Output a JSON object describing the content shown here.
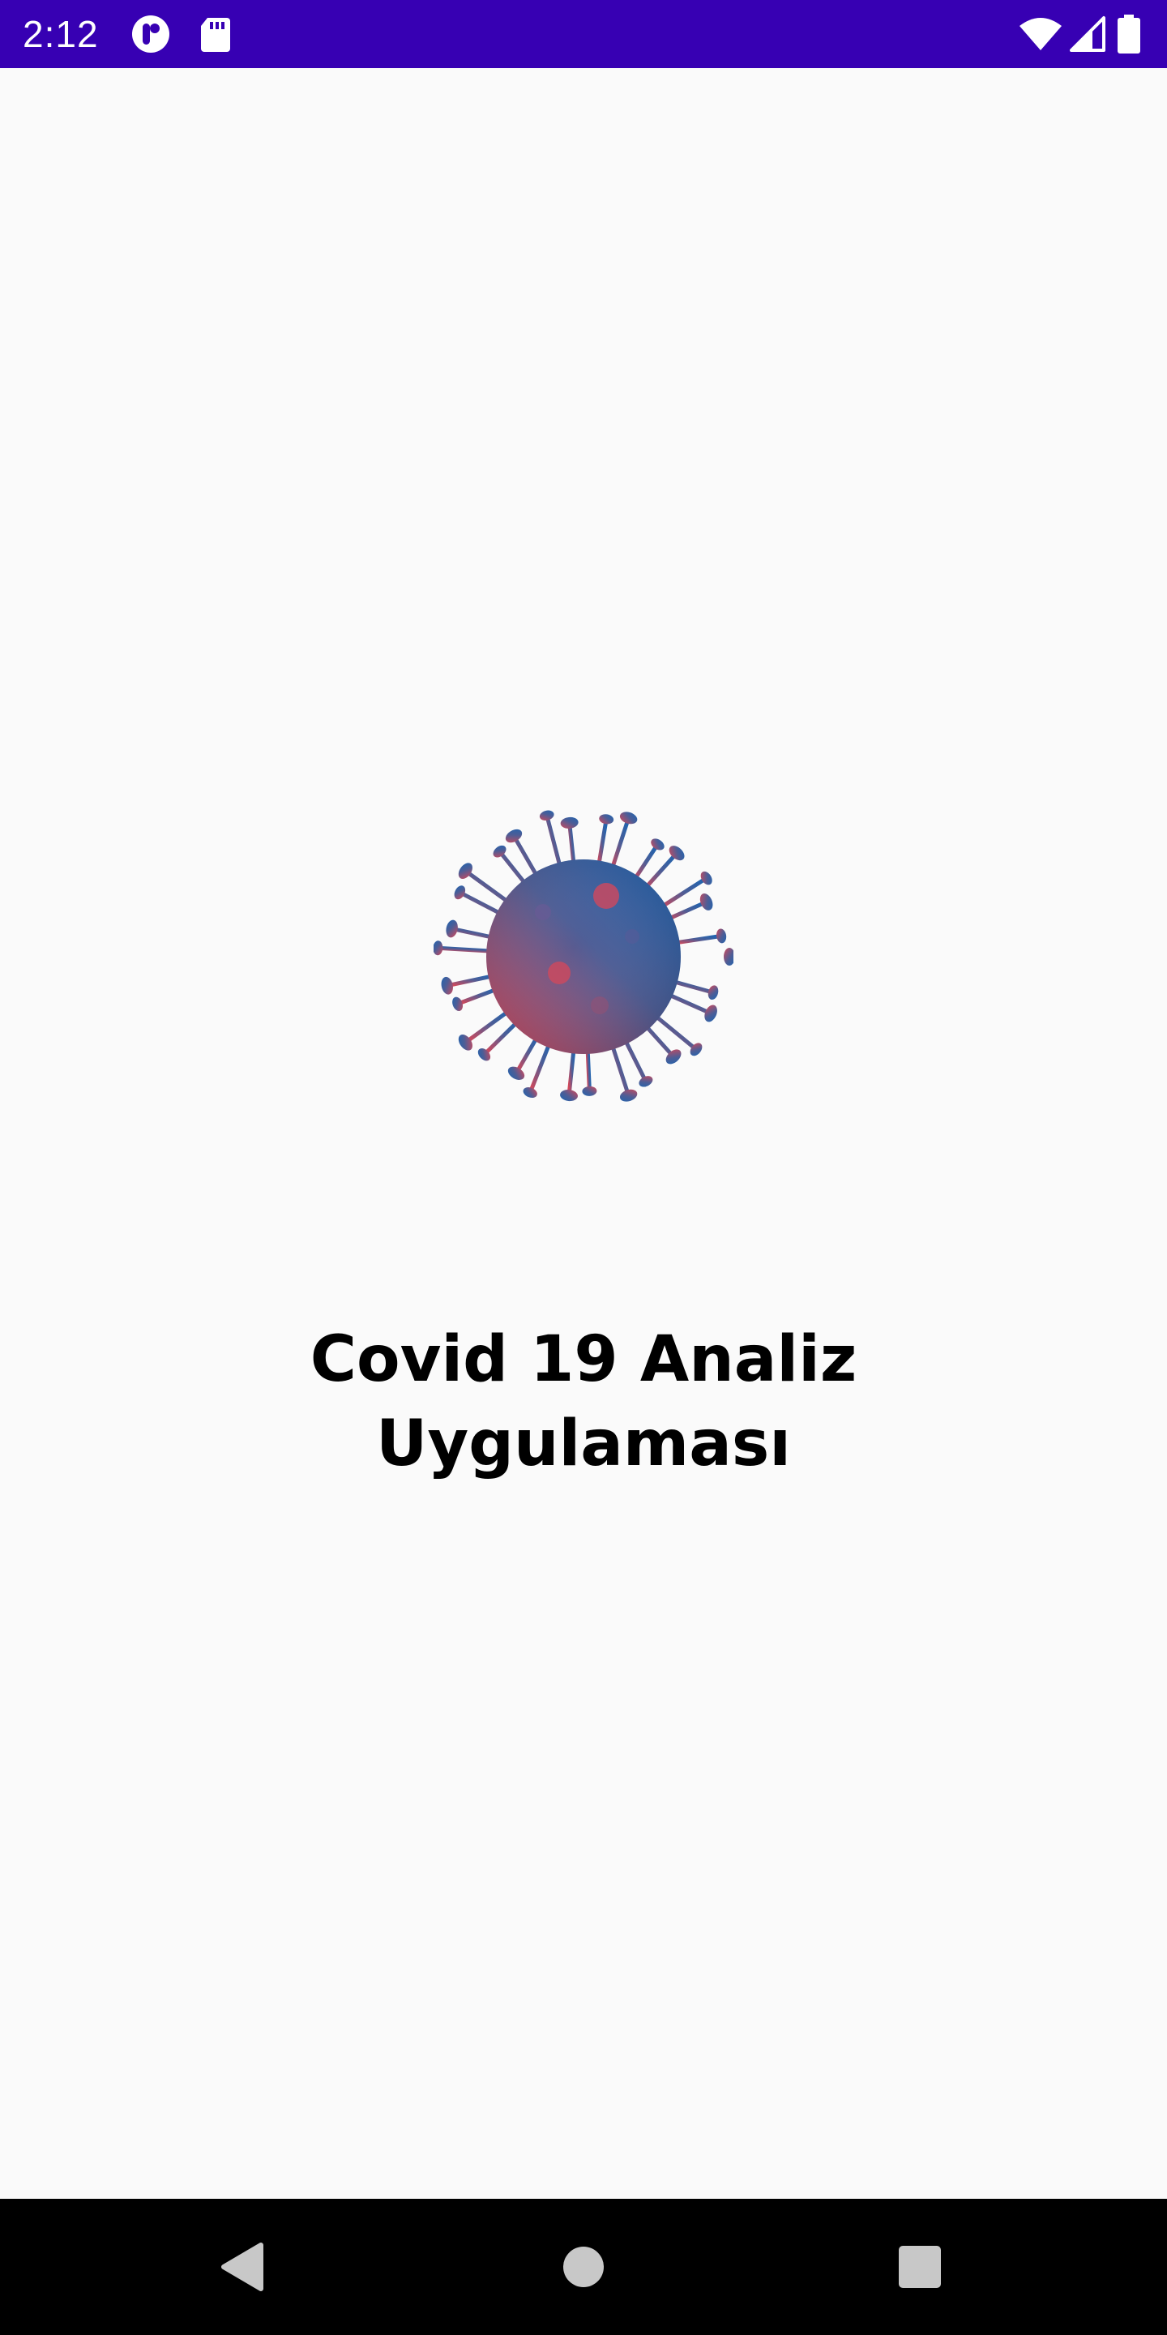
{
  "status_bar": {
    "time": "2:12",
    "background_color": "#3700b3",
    "left_icons": [
      "app-notification-icon",
      "sd-card-icon"
    ],
    "right_icons": [
      "wifi-icon",
      "cellular-signal-icon",
      "battery-icon"
    ]
  },
  "main": {
    "logo_icon": "coronavirus-icon",
    "title_line1": "Covid 19 Analiz",
    "title_line2": "Uygulaması",
    "logo_colors": {
      "blue": "#2f5fa0",
      "red": "#c0485a"
    }
  },
  "nav_bar": {
    "buttons": [
      "back-icon",
      "home-icon",
      "recents-icon"
    ]
  }
}
